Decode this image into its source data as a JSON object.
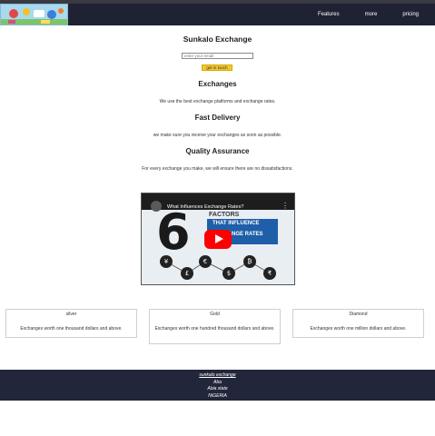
{
  "nav": {
    "links": [
      "Features",
      "more",
      "pricing"
    ]
  },
  "hero": {
    "title": "Sunkalo Exchange",
    "email_placeholder": "enter your email",
    "cta_label": "get in touch"
  },
  "sections": [
    {
      "title": "Exchanges",
      "text": "We use the best exchange platforms and exchange rates."
    },
    {
      "title": "Fast Delivery",
      "text": "we make sure you receive your exchanges as soon as possible."
    },
    {
      "title": "Quality Assurance",
      "text": "For every exchange you make, we will ensure there are no dissatisfactions."
    }
  ],
  "video": {
    "title": "What Influences Exchange Rates?",
    "big_number": "6",
    "line1": "FACTORS",
    "line2": "THAT INFLUENCE",
    "line3": "EXCHANGE RATES",
    "currency_symbols": [
      "¥",
      "£",
      "€",
      "$",
      "₿",
      "₹"
    ]
  },
  "plans": [
    {
      "name": "silver",
      "desc": "Exchanges worth one thousand dollars and above."
    },
    {
      "name": "Gold",
      "desc": "Exchanges worth one hundred thousand dollars and above."
    },
    {
      "name": "Diamond",
      "desc": "Exchanges worth one million dollars and above."
    }
  ],
  "footer": {
    "link": "sunkalo exchange",
    "lines": [
      "Aba",
      "Abia state",
      "NIGERIA"
    ]
  }
}
